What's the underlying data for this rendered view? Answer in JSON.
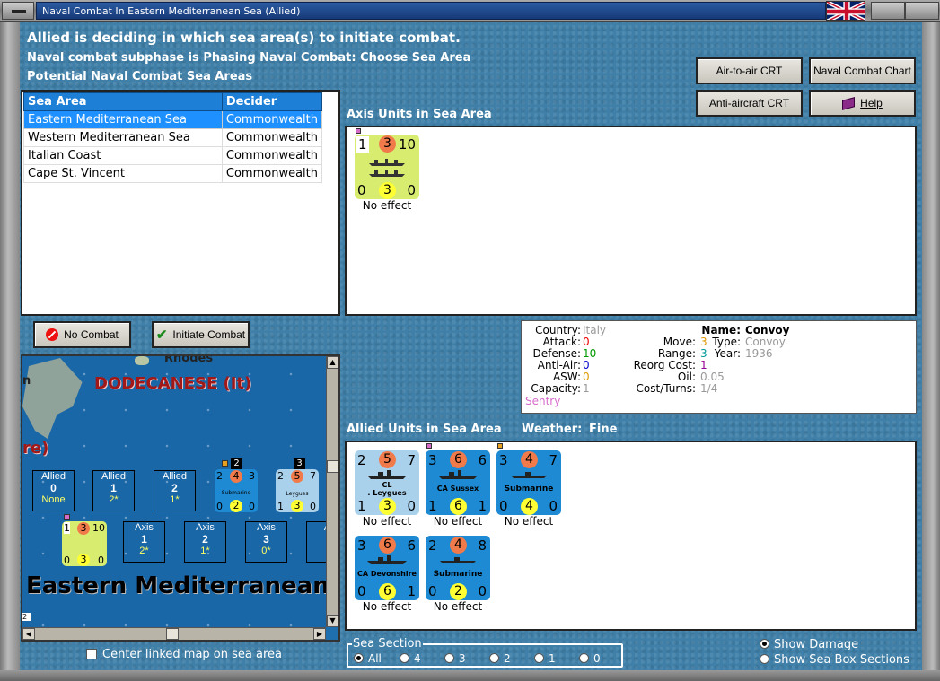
{
  "window": {
    "title": "Naval Combat In Eastern Mediterranean Sea (Allied)"
  },
  "header": {
    "line1": "Allied is deciding in which sea area(s) to initiate combat.",
    "line2": "Naval combat subphase is Phasing Naval Combat: Choose Sea Area",
    "line3": "Potential Naval Combat Sea Areas"
  },
  "buttons": {
    "air_to_air": "Air-to-air CRT",
    "naval_chart": "Naval Combat Chart",
    "anti_aircraft": "Anti-aircraft CRT",
    "help": "Help",
    "no_combat": "No Combat",
    "initiate_combat": "Initiate Combat"
  },
  "sea_table": {
    "headers": [
      "Sea Area",
      "Decider"
    ],
    "rows": [
      {
        "area": "Eastern Mediterranean Sea",
        "decider": "Commonwealth",
        "selected": true
      },
      {
        "area": "Western Mediterranean Sea",
        "decider": "Commonwealth"
      },
      {
        "area": "Italian Coast",
        "decider": "Commonwealth"
      },
      {
        "area": "Cape St. Vincent",
        "decider": "Commonwealth"
      }
    ]
  },
  "axis_units": {
    "label": "Axis Units in Sea Area",
    "units": [
      {
        "tl": "1",
        "top": "3",
        "tr": "10",
        "bl": "0",
        "bot": "3",
        "br": "0",
        "effect": "No effect"
      }
    ]
  },
  "info": {
    "country_k": "Country:",
    "country_v": "Italy",
    "attack_k": "Attack:",
    "attack_v": "0",
    "defense_k": "Defense:",
    "defense_v": "10",
    "antiair_k": "Anti-Air:",
    "antiair_v": "0",
    "asw_k": "ASW:",
    "asw_v": "0",
    "capacity_k": "Capacity:",
    "capacity_v": "1",
    "sentry": "Sentry",
    "move_k": "Move:",
    "move_v": "3",
    "range_k": "Range:",
    "range_v": "3",
    "reorg_k": "Reorg Cost:",
    "reorg_v": "1",
    "oil_k": "Oil:",
    "oil_v": "0.05",
    "cost_k": "Cost/Turns:",
    "cost_v": "1/4",
    "name_k": "Name:",
    "name_v": "Convoy",
    "type_k": "Type:",
    "type_v": "Convoy",
    "year_k": "Year:",
    "year_v": "1936"
  },
  "allied_units": {
    "label": "Allied Units in Sea Area",
    "weather_label": "Weather:",
    "weather": "Fine",
    "units": [
      {
        "tl": "2",
        "top": "5",
        "tr": "7",
        "bl": "1",
        "bot": "3",
        "br": "0",
        "name": "CL\n. Leygues",
        "effect": "No effect"
      },
      {
        "tl": "3",
        "top": "6",
        "tr": "6",
        "bl": "1",
        "bot": "6",
        "br": "1",
        "name": "CA Sussex",
        "effect": "No effect"
      },
      {
        "tl": "3",
        "top": "4",
        "tr": "7",
        "bl": "0",
        "bot": "4",
        "br": "0",
        "name": "Submarine",
        "effect": "No effect"
      },
      {
        "tl": "3",
        "top": "6",
        "tr": "6",
        "bl": "0",
        "bot": "6",
        "br": "1",
        "name": "CA Devonshire",
        "effect": "No effect"
      },
      {
        "tl": "2",
        "top": "4",
        "tr": "8",
        "bl": "0",
        "bot": "2",
        "br": "0",
        "name": "Submarine",
        "effect": "No effect"
      }
    ]
  },
  "map": {
    "rhodes": "Rhodes",
    "dodecanese": "DODECANESE (It)",
    "partial_label": "re)",
    "sea_label": "Eastern Mediterranean",
    "allied_boxes": [
      {
        "side": "Allied",
        "num": "0",
        "val": "None"
      },
      {
        "side": "Allied",
        "num": "1",
        "val": "2*"
      },
      {
        "side": "Allied",
        "num": "2",
        "val": "1*"
      }
    ],
    "axis_boxes": [
      {
        "side": "Axis",
        "num": "1",
        "val": "2*"
      },
      {
        "side": "Axis",
        "num": "2",
        "val": "1*"
      },
      {
        "side": "Axis",
        "num": "3",
        "val": "0*"
      },
      {
        "side": "A",
        "num": "",
        "val": ""
      }
    ],
    "stack_counts": [
      "2",
      "3"
    ],
    "mini_sub": {
      "tl": "2",
      "top": "4",
      "tr": "3",
      "bl": "0",
      "bot": "2",
      "br": "0",
      "name": "Submarine"
    },
    "mini_cl": {
      "tl": "2",
      "top": "5",
      "tr": "7",
      "bl": "1",
      "bot": "3",
      "br": "0",
      "name": "Leygues"
    },
    "mini_axis": {
      "tl": "1",
      "top": "3",
      "tr": "10",
      "bl": "0",
      "bot": "3",
      "br": "0"
    },
    "corner": "2",
    "edge_letter": "n"
  },
  "bottom": {
    "center_map": "Center linked map on sea area",
    "sea_section_label": "Sea Section",
    "sections": [
      "All",
      "4",
      "3",
      "2",
      "1",
      "0"
    ],
    "show_damage": "Show Damage",
    "show_sea_box": "Show Sea Box Sections"
  },
  "colors": {
    "panel_bg": "#3f7fa8",
    "selected_row": "#1e90ff",
    "header_row": "#1e7fd6"
  }
}
